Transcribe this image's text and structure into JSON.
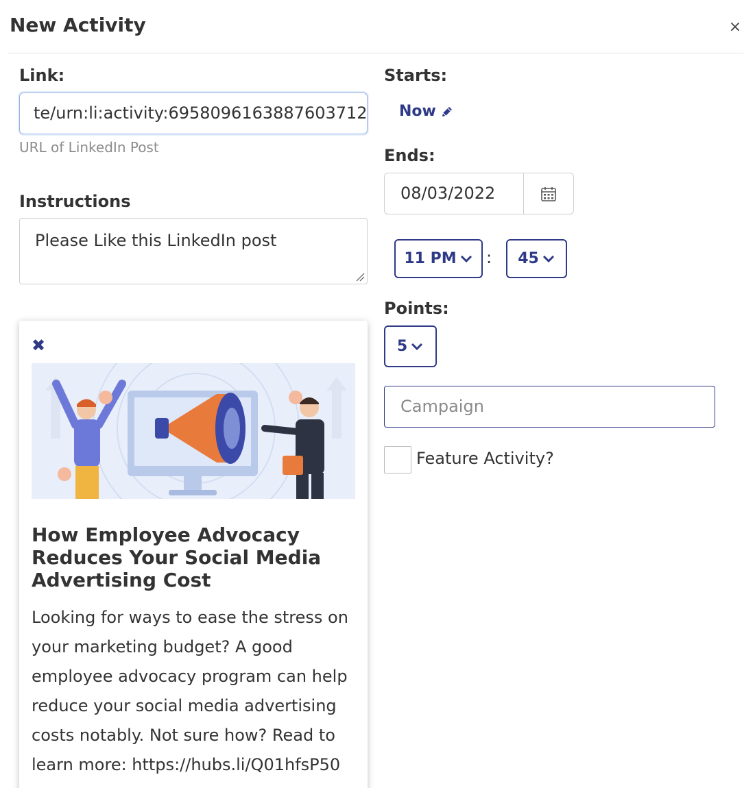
{
  "modal": {
    "title": "New Activity",
    "close_glyph": "×"
  },
  "link": {
    "label": "Link:",
    "value": "te/urn:li:activity:6958096163887603712",
    "help": "URL of LinkedIn Post"
  },
  "instructions": {
    "label": "Instructions",
    "value": "Please Like this LinkedIn post"
  },
  "preview": {
    "close_glyph": "✖",
    "title": "How Employee Advocacy Reduces Your Social Media Advertising Cost",
    "description": "Looking for ways to ease the stress on your marketing budget? A good employee advocacy program can help reduce your social media advertising costs notably. Not sure how? Read to learn more: https://hubs.li/Q01hfsP50"
  },
  "starts": {
    "label": "Starts:",
    "value": "Now",
    "icon": "pencil-icon"
  },
  "ends": {
    "label": "Ends:",
    "date": "08/03/2022",
    "hour": "11 PM",
    "separator": ":",
    "minute": "45",
    "icon": "calendar-icon"
  },
  "points": {
    "label": "Points:",
    "value": "5"
  },
  "campaign": {
    "placeholder": "Campaign"
  },
  "feature": {
    "label": "Feature Activity?",
    "checked": false
  },
  "colors": {
    "accent": "#2e3a87",
    "text": "#333333",
    "muted": "#8a8a8a",
    "focus_border": "#8fb3e6"
  }
}
